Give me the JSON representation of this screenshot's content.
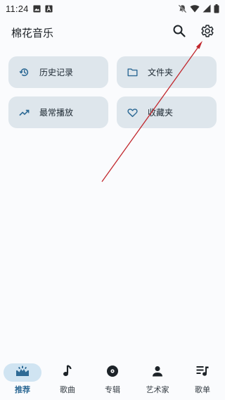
{
  "status_bar": {
    "time": "11:24",
    "left_icons": [
      "image-icon",
      "a-box-icon"
    ],
    "right_icons": [
      "notifications-off-icon",
      "wifi-icon",
      "signal-icon",
      "battery-icon"
    ]
  },
  "app_bar": {
    "title": "棉花音乐",
    "actions": [
      {
        "name": "search-button",
        "icon": "search-icon"
      },
      {
        "name": "settings-button",
        "icon": "gear-icon"
      }
    ]
  },
  "quick_links": [
    {
      "label": "历史记录",
      "icon": "history-icon"
    },
    {
      "label": "文件夹",
      "icon": "folder-icon"
    },
    {
      "label": "最常播放",
      "icon": "trending-up-icon"
    },
    {
      "label": "收藏夹",
      "icon": "heart-icon"
    }
  ],
  "bottom_nav": {
    "items": [
      {
        "label": "推荐",
        "icon": "recommend-icon",
        "active": true
      },
      {
        "label": "歌曲",
        "icon": "music-note-icon",
        "active": false
      },
      {
        "label": "专辑",
        "icon": "album-icon",
        "active": false
      },
      {
        "label": "艺术家",
        "icon": "person-icon",
        "active": false
      },
      {
        "label": "歌单",
        "icon": "playlist-icon",
        "active": false
      }
    ]
  },
  "colors": {
    "background": "#fafbfd",
    "card": "#dee6ec",
    "icon_accent": "#2e6a95",
    "active_pill": "#d0e4f2",
    "annotation_arrow": "#c1272d"
  }
}
